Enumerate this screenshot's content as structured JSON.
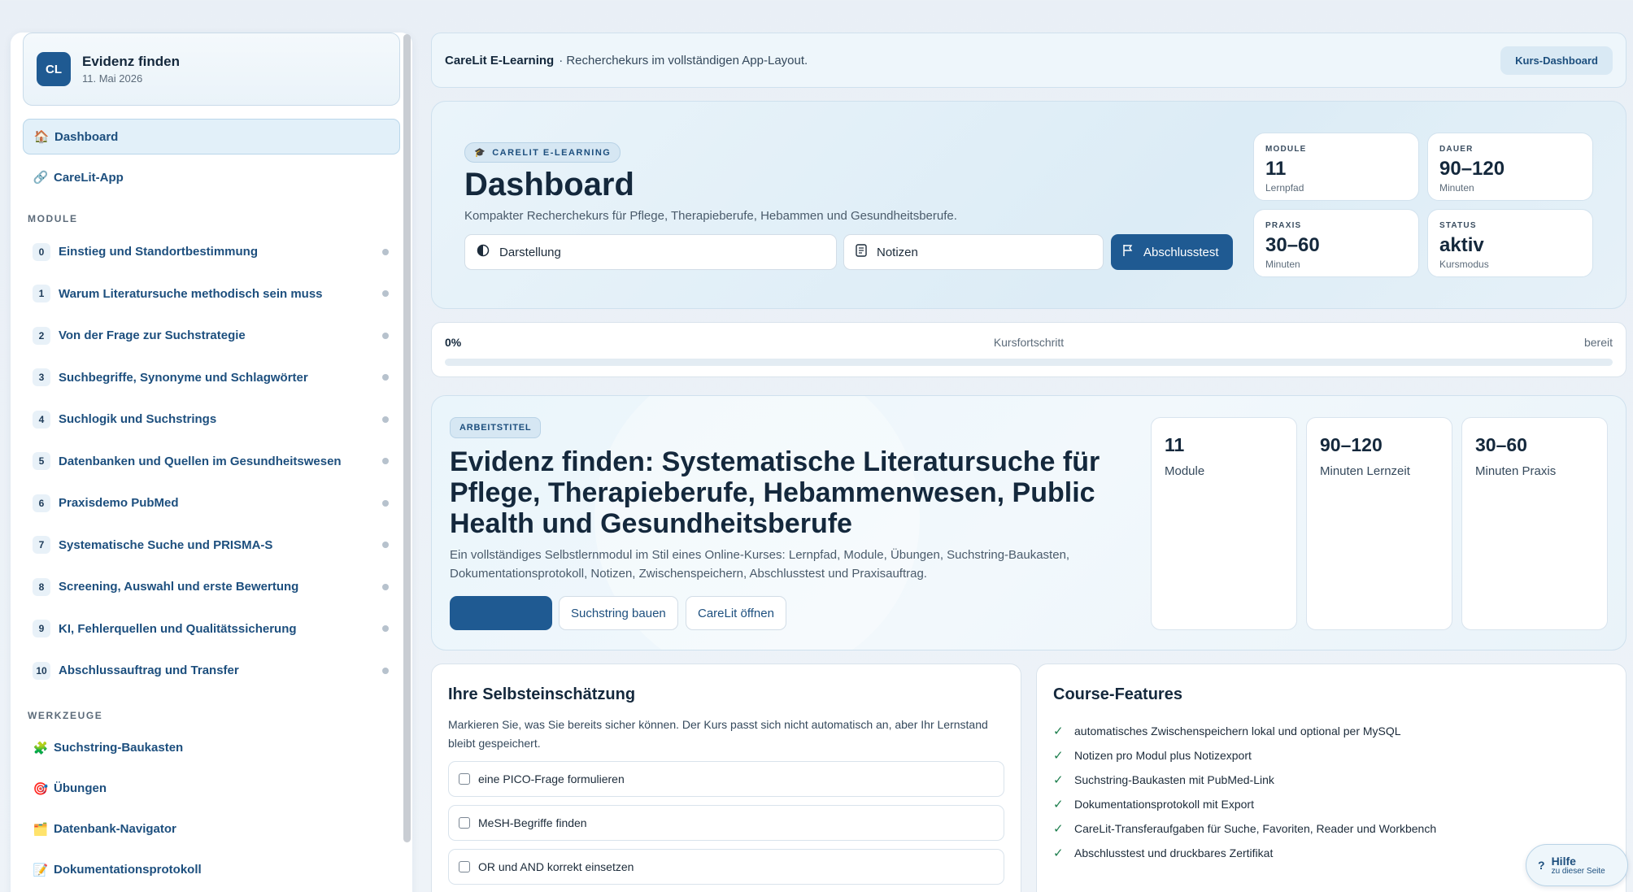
{
  "sidebar": {
    "logo": "CL",
    "title": "Evidenz finden",
    "date": "11. Mai 2026",
    "top_items": [
      {
        "emoji": "🏠",
        "label": "Dashboard"
      },
      {
        "emoji": "🔗",
        "label": "CareLit-App"
      }
    ],
    "modules_label": "MODULE",
    "modules": [
      {
        "num": "0",
        "label": "Einstieg und Standortbestimmung"
      },
      {
        "num": "1",
        "label": "Warum Literatursuche methodisch sein muss"
      },
      {
        "num": "2",
        "label": "Von der Frage zur Suchstrategie"
      },
      {
        "num": "3",
        "label": "Suchbegriffe, Synonyme und Schlagwörter"
      },
      {
        "num": "4",
        "label": "Suchlogik und Suchstrings"
      },
      {
        "num": "5",
        "label": "Datenbanken und Quellen im Gesundheitswesen"
      },
      {
        "num": "6",
        "label": "Praxisdemo PubMed"
      },
      {
        "num": "7",
        "label": "Systematische Suche und PRISMA-S"
      },
      {
        "num": "8",
        "label": "Screening, Auswahl und erste Bewertung"
      },
      {
        "num": "9",
        "label": "KI, Fehlerquellen und Qualitätssicherung"
      },
      {
        "num": "10",
        "label": "Abschlussauftrag und Transfer"
      }
    ],
    "tools_label": "WERKZEUGE",
    "tools": [
      {
        "emoji": "🧩",
        "label": "Suchstring-Baukasten"
      },
      {
        "emoji": "🎯",
        "label": "Übungen"
      },
      {
        "emoji": "🗂️",
        "label": "Datenbank-Navigator"
      },
      {
        "emoji": "📝",
        "label": "Dokumentationsprotokoll"
      }
    ]
  },
  "topbar": {
    "brand": "CareLit E-Learning",
    "subtitle": "· Recherchekurs im vollständigen App-Layout.",
    "dashboard_button": "Kurs-Dashboard"
  },
  "hero": {
    "pill": "CARELIT E-LEARNING",
    "title": "Dashboard",
    "description": "Kompakter Recherchekurs für Pflege, Therapieberufe, Hebammen und Gesundheitsberufe.",
    "btn_display": "Darstellung",
    "btn_notes": "Notizen",
    "btn_test": "Abschlusstest",
    "stats": [
      {
        "key": "MODULE",
        "value": "11",
        "sub": "Lernpfad"
      },
      {
        "key": "DAUER",
        "value": "90–120",
        "sub": "Minuten"
      },
      {
        "key": "PRAXIS",
        "value": "30–60",
        "sub": "Minuten"
      },
      {
        "key": "STATUS",
        "value": "aktiv",
        "sub": "Kursmodus"
      }
    ]
  },
  "progress": {
    "percent_label": "0%",
    "percent": 0,
    "label": "Kursfortschritt",
    "state": "bereit"
  },
  "course": {
    "pill": "ARBEITSTITEL",
    "title": "Evidenz finden: Systematische Literatursuche für Pflege, Therapieberufe, Hebammenwesen, Public Health und Gesundheitsberufe",
    "description": "Ein vollständiges Selbstlernmodul im Stil eines Online-Kurses: Lernpfad, Module, Übungen, Suchstring-Baukasten, Dokumentationsprotokoll, Notizen, Zwischenspeichern, Abschlusstest und Praxisauftrag.",
    "btn_primary": "",
    "btn_string": "Suchstring bauen",
    "btn_carelit": "CareLit öffnen",
    "kpis": [
      {
        "value": "11",
        "label": "Module"
      },
      {
        "value": "90–120",
        "label": "Minuten Lernzeit"
      },
      {
        "value": "30–60",
        "label": "Minuten Praxis"
      }
    ]
  },
  "self_assessment": {
    "title": "Ihre Selbsteinschätzung",
    "text": "Markieren Sie, was Sie bereits sicher können. Der Kurs passt sich nicht automatisch an, aber Ihr Lernstand bleibt gespeichert.",
    "items": [
      "eine PICO-Frage formulieren",
      "MeSH-Begriffe finden",
      "OR und AND korrekt einsetzen"
    ]
  },
  "features": {
    "title": "Course-Features",
    "items": [
      "automatisches Zwischenspeichern lokal und optional per MySQL",
      "Notizen pro Modul plus Notizexport",
      "Suchstring-Baukasten mit PubMed-Link",
      "Dokumentationsprotokoll mit Export",
      "CareLit-Transferaufgaben für Suche, Favoriten, Reader und Workbench",
      "Abschlusstest und druckbares Zertifikat"
    ]
  },
  "help": {
    "title": "Hilfe",
    "subtitle": "zu dieser Seite"
  },
  "colors": {
    "primary": "#1f5a92",
    "accent_bg": "#e2f0f9",
    "success": "#1e7f4e"
  }
}
